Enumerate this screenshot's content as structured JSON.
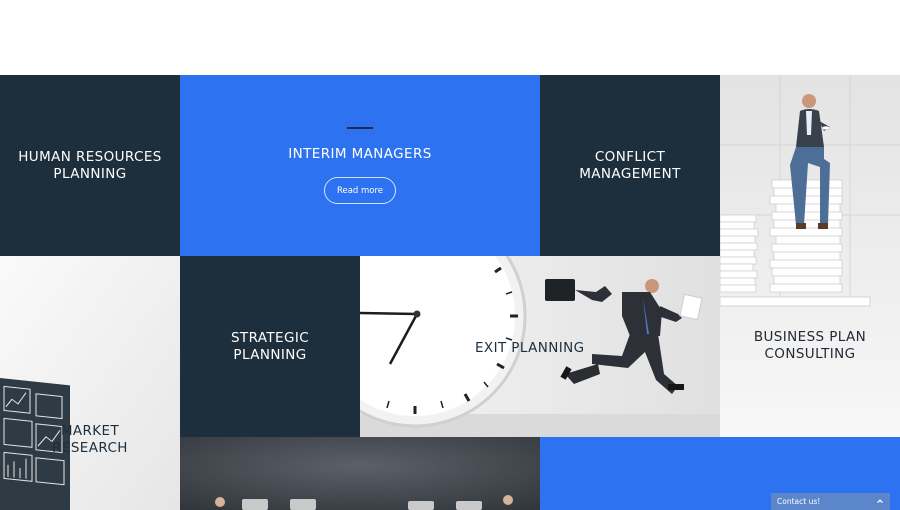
{
  "tiles": {
    "human_resources": "HUMAN RESOURCES PLANNING",
    "interim": {
      "title": "INTERIM MANAGERS",
      "button": "Read more"
    },
    "conflict": "CONFLICT MANAGEMENT",
    "strategic": "STRATEGIC PLANNING",
    "exit": "EXIT PLANNING",
    "business": "BUSINESS PLAN CONSULTING",
    "market": "MARKET RESEARCH"
  },
  "contact_widget": {
    "label": "Contact us!",
    "icon": "chevron-up-icon"
  },
  "colors": {
    "dark_tile": "#1d2e3c",
    "blue_tile": "#2d72f0",
    "contact_bar": "#5b86c9"
  }
}
